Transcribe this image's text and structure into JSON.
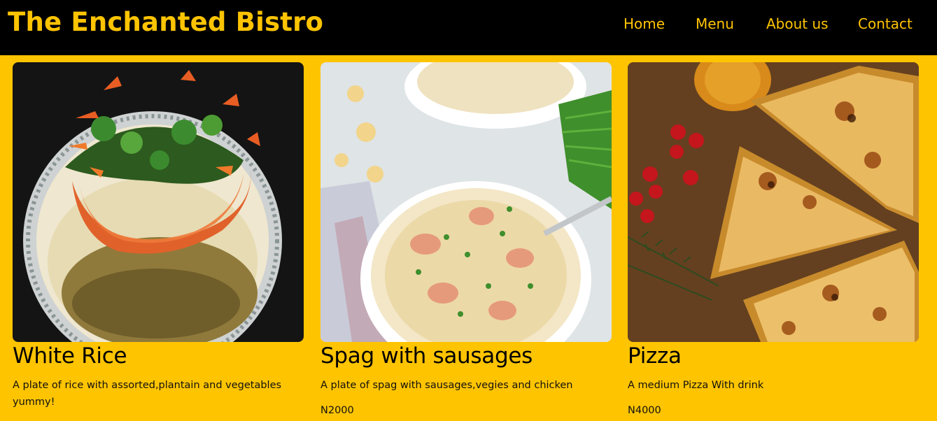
{
  "header": {
    "brand": "The Enchanted Bistro",
    "nav": [
      "Home",
      "Menu",
      "About us",
      "Contact"
    ]
  },
  "colors": {
    "accent": "#ffc400",
    "header_bg": "#000000"
  },
  "menu_items": [
    {
      "name": "White Rice",
      "description": "A plate of rice with assorted,plantain and vegetables yummy!",
      "price": "",
      "image": "plate-of-rice-with-vegetables"
    },
    {
      "name": "Spag with sausages",
      "description": "A plate of spag with sausages,vegies and chicken",
      "price": "N2000",
      "image": "bowls-of-pasta-with-sausages"
    },
    {
      "name": "Pizza",
      "description": "A medium Pizza With drink",
      "price": "N4000",
      "image": "sliced-pizza-on-board"
    }
  ]
}
